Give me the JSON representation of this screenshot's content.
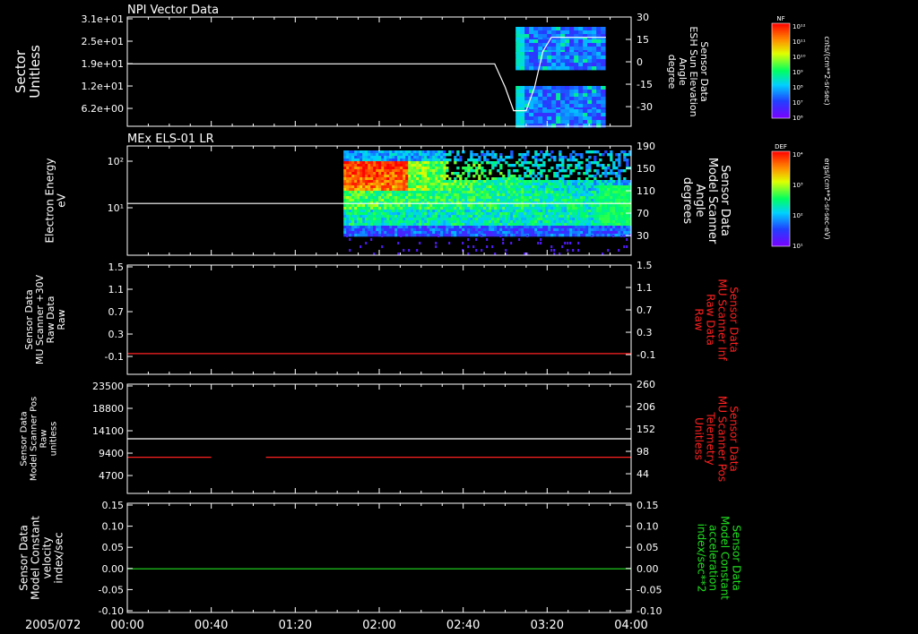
{
  "footer": {
    "date_label": "2005/072"
  },
  "time_axis": {
    "ticks": [
      "00:00",
      "00:40",
      "01:20",
      "02:00",
      "02:40",
      "03:20",
      "04:00"
    ]
  },
  "colors": {
    "white": "#ffffff",
    "red": "#ff2020",
    "green": "#20e020",
    "frame": "#ffffff",
    "bg": "#000000"
  },
  "panels": [
    {
      "title": "NPI Vector Data",
      "left_label": [
        "Sector",
        "Unitless"
      ],
      "left_ticks": [
        "3.1e+01",
        "2.5e+01",
        "1.9e+01",
        "1.2e+01",
        "6.2e+00"
      ],
      "right_label": [
        "Sensor Data",
        "ESH Sun Elevation",
        "Angle",
        "degree"
      ],
      "right_ticks": [
        "30",
        "15",
        "0",
        "-15",
        "-30"
      ]
    },
    {
      "title": "MEx ELS-01 LR",
      "left_label": [
        "Electron Energy",
        "eV"
      ],
      "left_ticks": [
        "10²",
        "10¹"
      ],
      "right_label": [
        "Sensor Data",
        "Model Scanner",
        "Angle",
        "degrees"
      ],
      "right_ticks": [
        "190",
        "150",
        "110",
        "70",
        "30"
      ]
    },
    {
      "title": "",
      "left_label": [
        "Sensor Data",
        "MU Scanner +30V",
        "Raw Data",
        "Raw"
      ],
      "left_ticks": [
        "1.5",
        "1.1",
        "0.7",
        "0.3",
        "-0.1"
      ],
      "right_label": [
        "Sensor Data",
        "MU Scanner Inf",
        "Raw Data",
        "Raw"
      ],
      "right_ticks": [
        "1.5",
        "1.1",
        "0.7",
        "0.3",
        "-0.1"
      ]
    },
    {
      "title": "",
      "left_label": [
        "Sensor Data",
        "Model Scanner Pos",
        "Raw",
        "unitless"
      ],
      "left_ticks": [
        "23500",
        "18800",
        "14100",
        "9400",
        "4700"
      ],
      "right_label": [
        "Sensor Data",
        "MU Scanner Pos",
        "Telemetry",
        "Unitless"
      ],
      "right_ticks": [
        "260",
        "206",
        "152",
        "98",
        "44"
      ]
    },
    {
      "title": "",
      "left_label": [
        "Sensor Data",
        "Model Constant",
        "velocity",
        "index/sec"
      ],
      "left_ticks": [
        "0.15",
        "0.10",
        "0.05",
        "0.00",
        "-0.05",
        "-0.10"
      ],
      "right_label": [
        "Sensor Data",
        "Model Constant",
        "acceleration",
        "index/sec**2"
      ],
      "right_ticks": [
        "0.15",
        "0.10",
        "0.05",
        "0.00",
        "-0.05",
        "-0.10"
      ]
    }
  ],
  "colorbars": [
    {
      "tag": "NF",
      "unit": "cnts/(cm**2-sr-sec)",
      "ticks": [
        "10¹²",
        "10¹¹",
        "10¹⁰",
        "10⁹",
        "10⁸",
        "10⁷",
        "10⁶"
      ]
    },
    {
      "tag": "DEF",
      "unit": "ergs/(cm**2-sr-sec-eV)",
      "ticks": [
        "10⁴",
        "10³",
        "10²",
        "10¹"
      ]
    }
  ],
  "chart_data": [
    {
      "type": "heatmap",
      "title": "NPI Vector Data",
      "x_range": [
        "00:00",
        "04:00"
      ],
      "left_axis": {
        "label": "Sector Unitless",
        "ticks": [
          31,
          25,
          19,
          12,
          6.2
        ]
      },
      "right_axis": {
        "label": "Sensor Data ESH Sun Elevation Angle degree",
        "range": [
          -40,
          30
        ]
      },
      "heatmap_time_span": [
        "03:05",
        "03:47"
      ],
      "series": [
        {
          "name": "Sensor Data ESH Sun Elevation Angle",
          "color": "#ffffff",
          "points": [
            [
              "00:00",
              0
            ],
            [
              "02:55",
              0
            ],
            [
              "03:00",
              -15
            ],
            [
              "03:04",
              -30
            ],
            [
              "03:10",
              -30
            ],
            [
              "03:14",
              -15
            ],
            [
              "03:18",
              8
            ],
            [
              "03:22",
              17
            ],
            [
              "03:48",
              17
            ]
          ]
        }
      ]
    },
    {
      "type": "heatmap",
      "title": "MEx ELS-01 LR",
      "x_range": [
        "00:00",
        "04:00"
      ],
      "left_axis": {
        "label": "Electron Energy eV",
        "scale": "log",
        "ticks": [
          100,
          10
        ]
      },
      "right_axis": {
        "label": "Sensor Data Model Scanner Angle degrees",
        "range": [
          0,
          190
        ]
      },
      "heatmap_time_span": [
        "01:43",
        "04:00"
      ],
      "series": [
        {
          "name": "Sensor Data Model Scanner Angle",
          "color": "#ffffff",
          "points": [
            [
              "00:00",
              90
            ],
            [
              "04:00",
              90
            ]
          ]
        }
      ]
    },
    {
      "type": "line",
      "x_range": [
        "00:00",
        "04:00"
      ],
      "left_axis": {
        "label": "Sensor Data MU Scanner +30V Raw Data Raw",
        "range": [
          -0.35,
          1.5
        ]
      },
      "right_axis": {
        "label": "Sensor Data MU Scanner Inf Raw Data Raw",
        "range": [
          -0.35,
          1.5
        ]
      },
      "series": [
        {
          "name": "Sensor Data MU Scanner Inf Raw Data",
          "color": "#ff2020",
          "points": [
            [
              "00:00",
              0.0
            ],
            [
              "04:00",
              0.0
            ]
          ]
        }
      ]
    },
    {
      "type": "line",
      "x_range": [
        "00:00",
        "04:00"
      ],
      "left_axis": {
        "label": "Sensor Data Model Scanner Pos Raw unitless",
        "range": [
          0,
          23500
        ]
      },
      "right_axis": {
        "label": "Sensor Data MU Scanner Pos Telemetry Unitless",
        "range": [
          0,
          260
        ]
      },
      "series": [
        {
          "name": "Sensor Data Model Scanner Pos",
          "color": "#ffffff",
          "points": [
            [
              "00:00",
              11750
            ],
            [
              "04:00",
              11750
            ]
          ]
        },
        {
          "name": "Sensor Data MU Scanner Pos Telemetry",
          "color": "#ff2020",
          "segments": [
            [
              [
                "00:00",
                86
              ],
              [
                "00:40",
                86
              ]
            ],
            [
              [
                "01:06",
                86
              ],
              [
                "04:00",
                86
              ]
            ]
          ]
        }
      ]
    },
    {
      "type": "line",
      "x_range": [
        "00:00",
        "04:00"
      ],
      "left_axis": {
        "label": "Sensor Data Model Constant velocity index/sec",
        "range": [
          -0.1,
          0.15
        ]
      },
      "right_axis": {
        "label": "Sensor Data Model Constant acceleration index/sec**2",
        "range": [
          -0.1,
          0.15
        ]
      },
      "series": [
        {
          "name": "Sensor Data Model Constant acceleration",
          "color": "#20e020",
          "points": [
            [
              "00:00",
              0.0
            ],
            [
              "04:00",
              0.0
            ]
          ]
        }
      ]
    }
  ]
}
